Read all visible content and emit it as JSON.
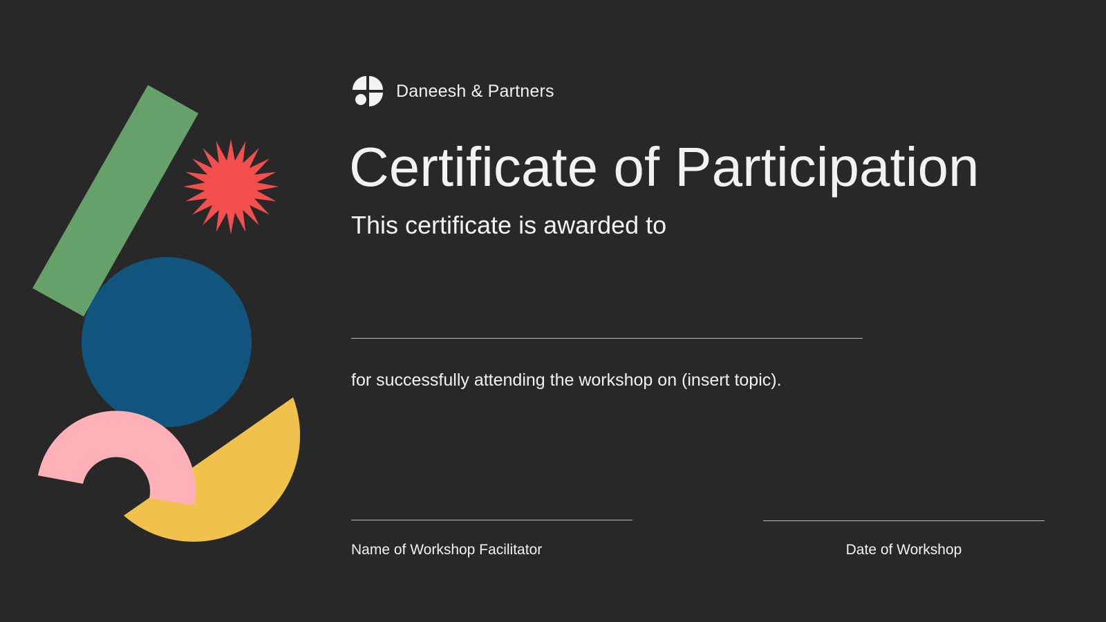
{
  "brand": {
    "name": "Daneesh & Partners",
    "logo_icon": "quartered-circle-logo-icon"
  },
  "certificate": {
    "title": "Certificate of Participation",
    "subtitle": "This certificate is awarded to",
    "statement": "for successfully attending the workshop on (insert topic).",
    "signatures": [
      {
        "label": "Name of Workshop Facilitator"
      },
      {
        "label": "Date of Workshop"
      }
    ]
  },
  "colors": {
    "background": "#282828",
    "text": "#f2f2f2",
    "line": "#bdbdbd",
    "green": "#66a16c",
    "red": "#f44f4f",
    "blue": "#11547e",
    "pink": "#ffb1b7",
    "yellow": "#f0c24c"
  },
  "decorations": [
    "green-bar-shape",
    "red-starburst-shape",
    "blue-circle-shape",
    "yellow-half-disc-shape",
    "pink-arc-shape"
  ]
}
